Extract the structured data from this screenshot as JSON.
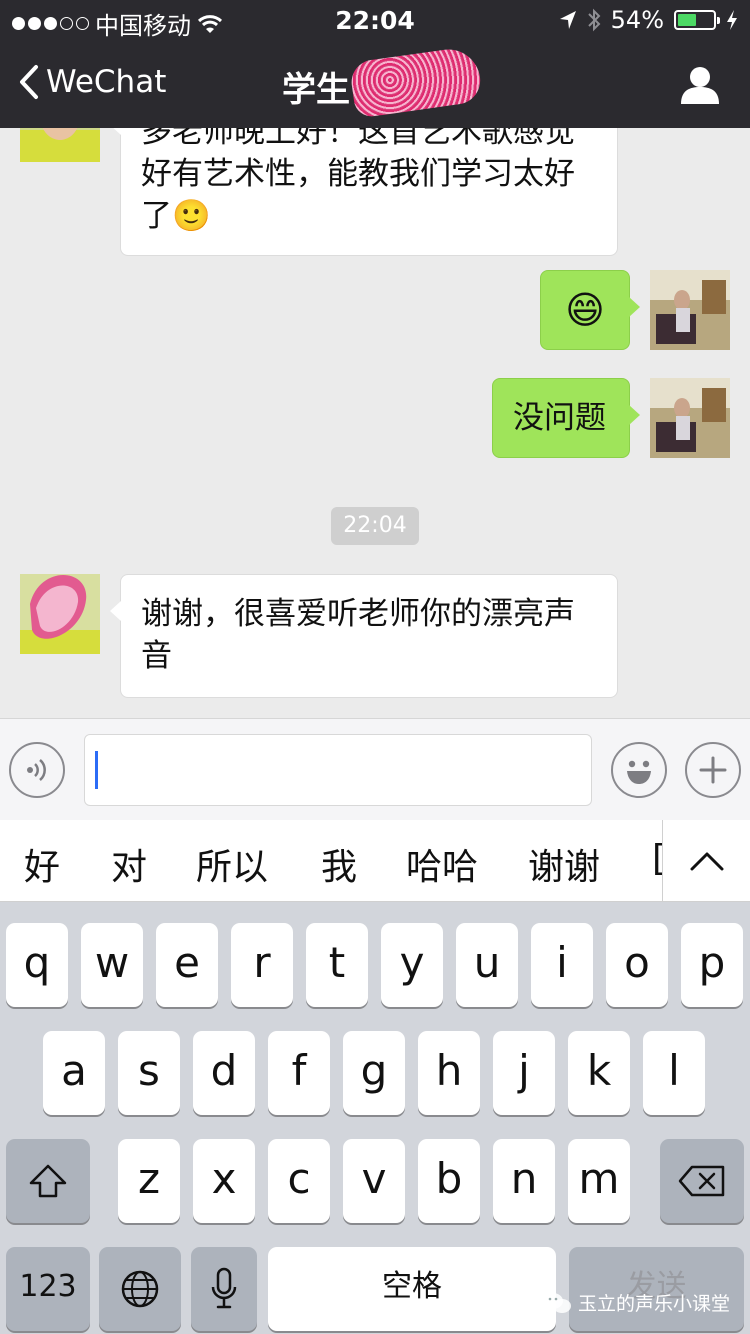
{
  "status_bar": {
    "carrier": "中国移动",
    "time": "22:04",
    "battery_percent": "54%",
    "battery_level": 0.54,
    "icons": [
      "signal-dots-icon",
      "wifi-icon",
      "location-arrow-icon",
      "bluetooth-icon",
      "battery-icon",
      "charging-bolt-icon"
    ]
  },
  "nav": {
    "back_label": "WeChat",
    "title": "学生",
    "icons": [
      "chevron-left-icon",
      "user-profile-icon"
    ]
  },
  "chat": {
    "messages": [
      {
        "side": "left",
        "text": "多老师晚上好！这首艺术歌感觉好有艺术性，能教我们学习太好了🙂"
      },
      {
        "side": "right",
        "text": "😄"
      },
      {
        "side": "right",
        "text": "没问题"
      },
      {
        "side": "left",
        "text": "谢谢，很喜爱听老师你的漂亮声音"
      }
    ],
    "timestamp": "22:04"
  },
  "input_bar": {
    "value": "",
    "icons": [
      "voice-icon",
      "emoji-icon",
      "plus-icon"
    ]
  },
  "candidates": {
    "items": [
      "好",
      "对",
      "所以",
      "我",
      "哈哈",
      "谢谢",
      "[",
      ""
    ],
    "icons": [
      "chevron-up-icon"
    ]
  },
  "keyboard": {
    "row1": [
      "q",
      "w",
      "e",
      "r",
      "t",
      "y",
      "u",
      "i",
      "o",
      "p"
    ],
    "row2": [
      "a",
      "s",
      "d",
      "f",
      "g",
      "h",
      "j",
      "k",
      "l"
    ],
    "row3": [
      "z",
      "x",
      "c",
      "v",
      "b",
      "n",
      "m"
    ],
    "numbers_label": "123",
    "space_label": "空格",
    "send_label": "发送",
    "icons": [
      "shift-icon",
      "delete-icon",
      "globe-icon",
      "microphone-icon"
    ]
  },
  "watermark": {
    "text": "玉立的声乐小课堂",
    "icon": "wechat-logo-icon"
  },
  "colors": {
    "nav_bg": "#2b2a2f",
    "chat_bg": "#ebebeb",
    "green_bubble": "#9fe45a",
    "white_bubble": "#ffffff",
    "battery_green": "#4cd964",
    "keyboard_bg": "#d2d5db",
    "caret_blue": "#2b6cf6"
  }
}
